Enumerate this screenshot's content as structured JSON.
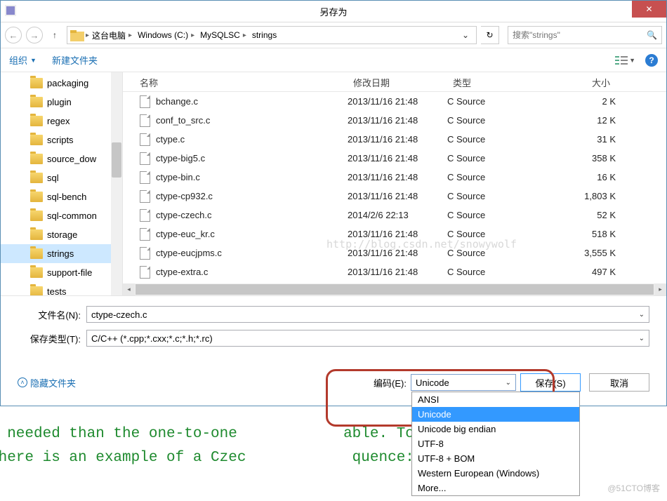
{
  "title": "另存为",
  "breadcrumb": [
    "这台电脑",
    "Windows (C:)",
    "MySQLSC",
    "strings"
  ],
  "search_placeholder": "搜索\"strings\"",
  "toolbar": {
    "organize": "组织",
    "newfolder": "新建文件夹"
  },
  "tree": [
    "packaging",
    "plugin",
    "regex",
    "scripts",
    "source_dow",
    "sql",
    "sql-bench",
    "sql-common",
    "storage",
    "strings",
    "support-file",
    "tests"
  ],
  "tree_sel_index": 9,
  "columns": {
    "name": "名称",
    "date": "修改日期",
    "type": "类型",
    "size": "大小"
  },
  "files": [
    {
      "n": "bchange.c",
      "d": "2013/11/16 21:48",
      "t": "C Source",
      "s": "2 K"
    },
    {
      "n": "conf_to_src.c",
      "d": "2013/11/16 21:48",
      "t": "C Source",
      "s": "12 K"
    },
    {
      "n": "ctype.c",
      "d": "2013/11/16 21:48",
      "t": "C Source",
      "s": "31 K"
    },
    {
      "n": "ctype-big5.c",
      "d": "2013/11/16 21:48",
      "t": "C Source",
      "s": "358 K"
    },
    {
      "n": "ctype-bin.c",
      "d": "2013/11/16 21:48",
      "t": "C Source",
      "s": "16 K"
    },
    {
      "n": "ctype-cp932.c",
      "d": "2013/11/16 21:48",
      "t": "C Source",
      "s": "1,803 K"
    },
    {
      "n": "ctype-czech.c",
      "d": "2014/2/6 22:13",
      "t": "C Source",
      "s": "52 K"
    },
    {
      "n": "ctype-euc_kr.c",
      "d": "2013/11/16 21:48",
      "t": "C Source",
      "s": "518 K"
    },
    {
      "n": "ctype-eucjpms.c",
      "d": "2013/11/16 21:48",
      "t": "C Source",
      "s": "3,555 K"
    },
    {
      "n": "ctype-extra.c",
      "d": "2013/11/16 21:48",
      "t": "C Source",
      "s": "497 K"
    }
  ],
  "watermark": "http://blog.csdn.net/snowywolf",
  "form": {
    "filename_label": "文件名(N):",
    "filename_value": "ctype-czech.c",
    "savetype_label": "保存类型(T):",
    "savetype_value": "C/C++ (*.cpp;*.cxx;*.c;*.h;*.rc)"
  },
  "footer": {
    "hidden": "隐藏文件夹",
    "encoding_label": "编码(E):",
    "encoding_value": "Unicode",
    "encoding_options": [
      "ANSI",
      "Unicode",
      "Unicode big endian",
      "UTF-8",
      "UTF-8 + BOM",
      "Western European (Windows)",
      "More..."
    ],
    "encoding_sel_index": 1,
    "save": "保存(S)",
    "cancel": "取消"
  },
  "bgtext": "s needed than the one-to-one            able. To\n here is an example of a Czec            quence:",
  "blogmark": "@51CTO博客"
}
